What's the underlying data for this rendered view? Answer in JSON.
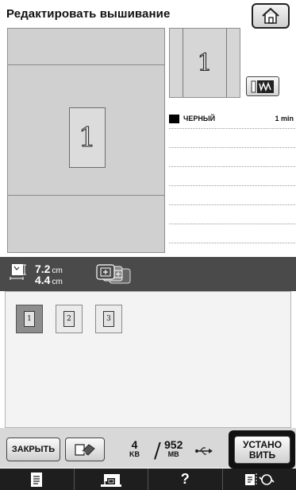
{
  "header": {
    "title": "Редактировать вышивание",
    "home_icon": "home-icon"
  },
  "design": {
    "glyph": "1"
  },
  "preview": {
    "glyph": "1",
    "button_icon": "stitch-preview-icon"
  },
  "colors": {
    "items": [
      {
        "name": "ЧЕРНЫЙ",
        "time": "1 min",
        "swatch": "#000000"
      }
    ],
    "empty_rows": 6
  },
  "size": {
    "width_value": "7.2",
    "width_unit": "cm",
    "height_value": "4.4",
    "height_unit": "cm"
  },
  "patterns": [
    {
      "glyph": "1",
      "selected": true
    },
    {
      "glyph": "2",
      "selected": false
    },
    {
      "glyph": "3",
      "selected": false
    }
  ],
  "buttons": {
    "close_label": "ЗАКРЫТЬ",
    "set_label_line1": "УСТАНО",
    "set_label_line2": "ВИТЬ"
  },
  "memory": {
    "used": "4",
    "used_unit": "KB",
    "total": "952",
    "total_unit": "MB"
  },
  "nav": {
    "help_label": "?",
    "icons": [
      "document-icon",
      "sewing-machine-icon",
      "help-icon",
      "settings-icon"
    ]
  }
}
